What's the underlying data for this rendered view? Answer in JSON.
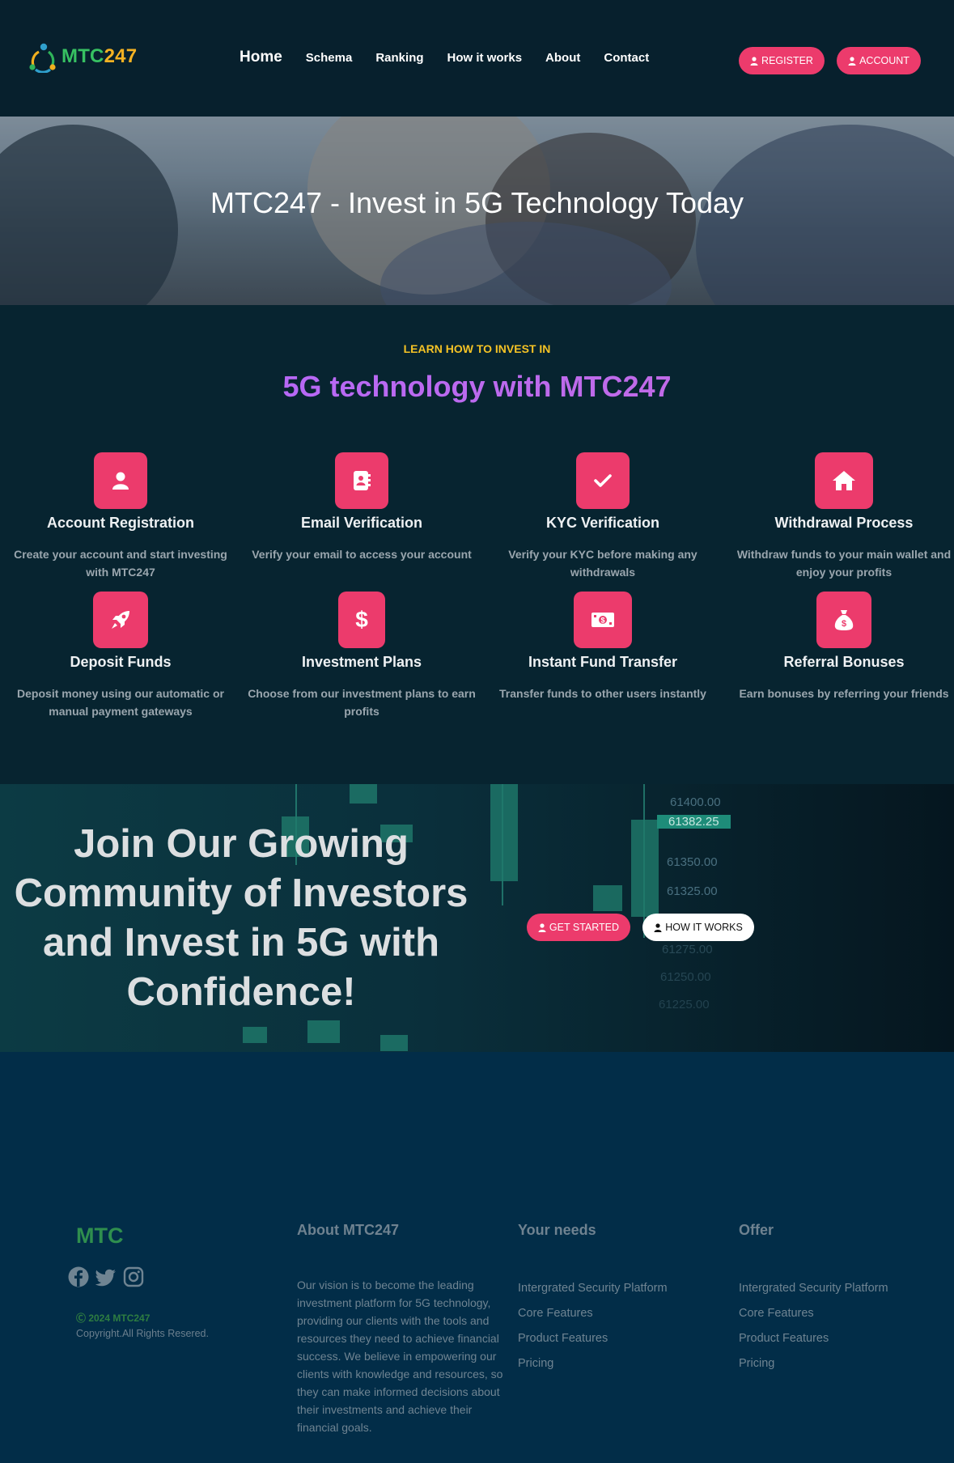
{
  "header": {
    "logo": {
      "part1": "MTC",
      "part2": "247"
    },
    "nav": [
      {
        "label": "Home",
        "active": true
      },
      {
        "label": "Schema"
      },
      {
        "label": "Ranking"
      },
      {
        "label": "How it works"
      },
      {
        "label": "About"
      },
      {
        "label": "Contact"
      }
    ],
    "register_label": "REGISTER",
    "account_label": "ACCOUNT"
  },
  "hero": {
    "title": "MTC247 - Invest in 5G Technology Today"
  },
  "learn": {
    "kicker": "LEARN HOW TO INVEST IN",
    "title": "5G technology with MTC247",
    "features": [
      {
        "icon": "user-icon",
        "title": "Account Registration",
        "text": "Create your account and start investing with MTC247"
      },
      {
        "icon": "address-book-icon",
        "title": "Email Verification",
        "text": "Verify your email to access your account"
      },
      {
        "icon": "check-icon",
        "title": "KYC Verification",
        "text": "Verify your KYC before making any withdrawals"
      },
      {
        "icon": "home-icon",
        "title": "Withdrawal Process",
        "text": "Withdraw funds to your main wallet and enjoy your profits"
      },
      {
        "icon": "rocket-icon",
        "title": "Deposit Funds",
        "text": "Deposit money using our automatic or manual payment gateways"
      },
      {
        "icon": "dollar-icon",
        "title": "Investment Plans",
        "text": "Choose from our investment plans to earn profits"
      },
      {
        "icon": "money-bill-icon",
        "title": "Instant Fund Transfer",
        "text": "Transfer funds to other users instantly"
      },
      {
        "icon": "money-bag-icon",
        "title": "Referral Bonuses",
        "text": "Earn bonuses by referring your friends"
      }
    ]
  },
  "join": {
    "title": "Join Our Growing Community of Investors and Invest in 5G with Confidence!",
    "get_started_label": "GET STARTED",
    "how_it_works_label": "HOW IT WORKS",
    "prices": [
      "61400.00",
      "61382.25",
      "61350.00",
      "61325.00",
      "61275.00",
      "61250.00",
      "61225.00"
    ]
  },
  "footer": {
    "brand": "MTC",
    "copyright": "Ⓒ 2024 MTC247",
    "rights": "Copyright.All Rights Resered.",
    "about_title": "About MTC247",
    "about_text": "Our vision is to become the leading investment platform for 5G technology, providing our clients with the tools and resources they need to achieve financial success. We believe in empowering our clients with knowledge and resources, so they can make informed decisions about their investments and achieve their financial goals.",
    "needs_title": "Your needs",
    "needs": [
      "Intergrated Security Platform",
      "Core Features",
      "Product Features",
      "Pricing"
    ],
    "offer_title": "Offer",
    "offer": [
      "Intergrated Security Platform",
      "Core Features",
      "Product Features",
      "Pricing"
    ]
  },
  "colors": {
    "accent": "#ec3b6c",
    "kicker": "#f5c325",
    "purple": "#b067ff",
    "brand_green": "#37c162",
    "brand_yellow": "#f4b223"
  }
}
